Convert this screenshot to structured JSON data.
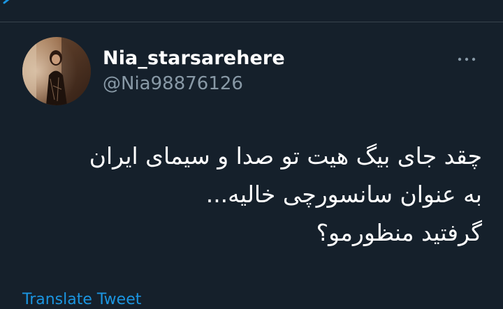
{
  "colors": {
    "background": "#15202b",
    "primary_text": "#ffffff",
    "secondary_text": "#8899a6",
    "accent": "#1b95e0",
    "divider": "#38444d"
  },
  "icons": {
    "back": "back-arrow-icon",
    "more": "more-horizontal-icon"
  },
  "tweet": {
    "author": {
      "display_name": "Nia_starsarehere",
      "handle": "@Nia98876126"
    },
    "lines": [
      "چقد جای بیگ هیت تو صدا و سیمای ایران",
      "به عنوان سانسورچی خالیه...",
      "گرفتید منظورمو؟"
    ]
  },
  "translate_label": "Translate Tweet"
}
